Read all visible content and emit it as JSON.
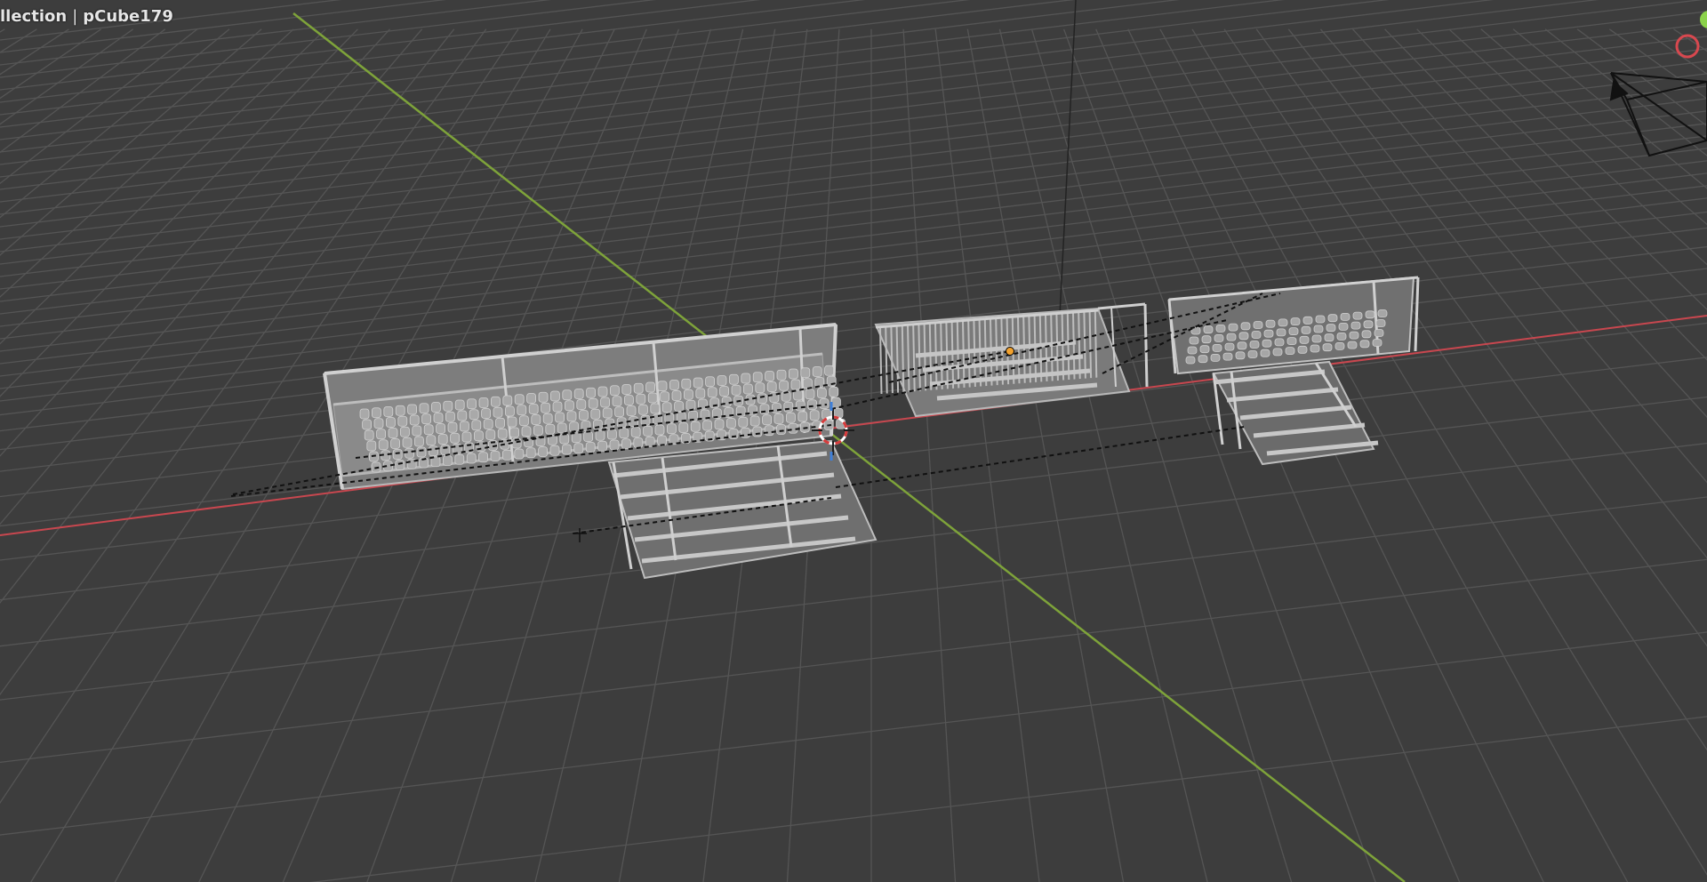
{
  "viewport": {
    "collection_label": "llection",
    "object_name": "pCube179"
  },
  "colors": {
    "background": "#3d3d3d",
    "grid_line": "#555555",
    "x_axis": "#c8474f",
    "y_axis": "#7ea33a",
    "mesh": "#8f8f8f",
    "mesh_edge": "#c7c7c7",
    "relationship_line": "#111111",
    "origin_dot": "#f2a22f",
    "gizmo_x": "#d8484f",
    "gizmo_y": "#8bd24a",
    "camera": "#111111"
  },
  "icons": {
    "cursor": "3d-cursor-icon",
    "camera": "camera-icon",
    "gizmo": "navigation-gizmo-icon"
  }
}
